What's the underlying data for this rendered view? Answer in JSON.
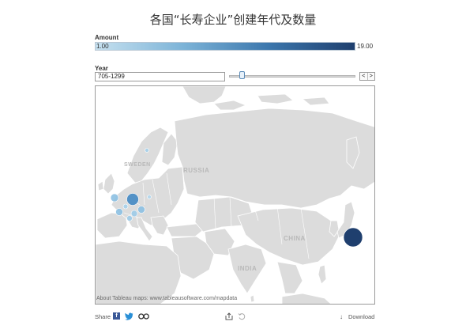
{
  "title": "各国“长寿企业”创建年代及数量",
  "legend": {
    "label": "Amount",
    "min": "1.00",
    "max": "19.00",
    "colors": [
      "#c6e0ef",
      "#7db4d8",
      "#3c77ad",
      "#1f3f6e"
    ]
  },
  "year_filter": {
    "label": "Year",
    "value": "705-1299",
    "prev_label": "<",
    "next_label": ">"
  },
  "map": {
    "country_labels": {
      "russia": "RUSSIA",
      "sweden": "SWEDEN",
      "china": "CHINA",
      "india": "INDIA"
    },
    "attribution": "About Tableau maps: www.tableausoftware.com/mapdata",
    "land_color": "#dcdcdc",
    "border_color": "#ffffff"
  },
  "footer": {
    "share_label": "Share",
    "download_label": "Download",
    "icons": [
      "facebook-icon",
      "twitter-icon",
      "link-icon",
      "export-icon",
      "revert-icon",
      "download-icon"
    ]
  }
}
